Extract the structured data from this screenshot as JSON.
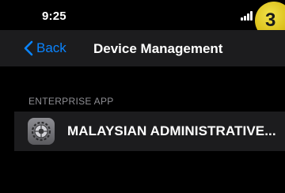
{
  "status_bar": {
    "time": "9:25"
  },
  "step_badge": "3",
  "nav": {
    "back_label": "Back",
    "title": "Device Management"
  },
  "section": {
    "header": "ENTERPRISE APP",
    "items": [
      {
        "label": "MALAYSIAN ADMINISTRATIVE...",
        "icon": "settings-gear-icon"
      }
    ]
  },
  "colors": {
    "accent": "#0a84ff",
    "badge": "#e6c823",
    "background": "#000000",
    "row": "#1c1c1e"
  }
}
